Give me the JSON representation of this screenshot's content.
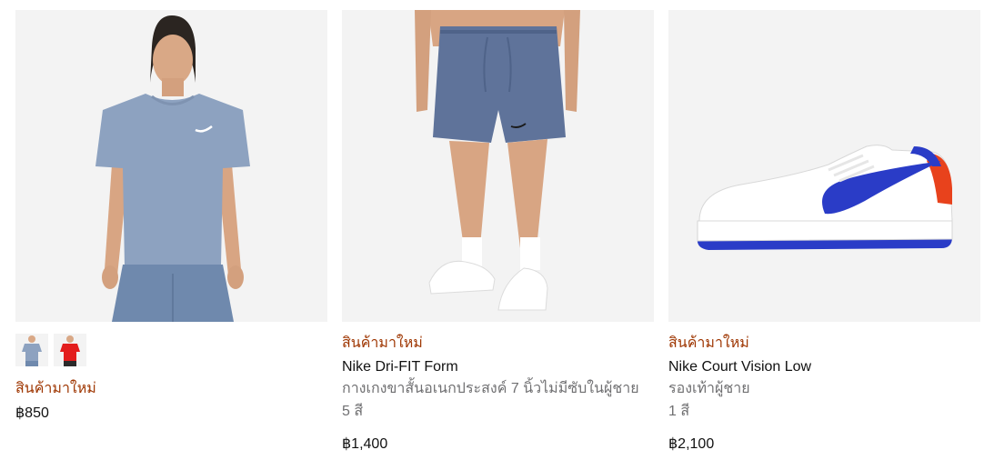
{
  "products": [
    {
      "image_alt": "blue t-shirt with logo",
      "thumbnails": [
        "blue t-shirt thumbnail",
        "red t-shirt thumbnail"
      ],
      "badge": "สินค้ามาใหม่",
      "price": "฿850"
    },
    {
      "image_alt": "blue shorts",
      "badge": "สินค้ามาใหม่",
      "name": "Nike Dri-FIT Form",
      "subtitle": "กางเกงขาสั้นอเนกประสงค์ 7 นิ้วไม่มีซับในผู้ชาย",
      "colors": "5 สี",
      "price": "฿1,400"
    },
    {
      "image_alt": "white sneaker with blue swoosh",
      "badge": "สินค้ามาใหม่",
      "name": "Nike Court Vision Low",
      "subtitle": "รองเท้าผู้ชาย",
      "colors": "1 สี",
      "price": "฿2,100"
    }
  ],
  "colors": {
    "badge": "#9e3500",
    "muted": "#707072",
    "text": "#111111",
    "image_bg": "#f5f5f5",
    "shirt_blue": "#8da2c0",
    "shorts_blue": "#5f739a",
    "swoosh_blue": "#2a3cc7",
    "shoe_accent": "#e8421c",
    "thumb_red": "#e31d1d"
  }
}
